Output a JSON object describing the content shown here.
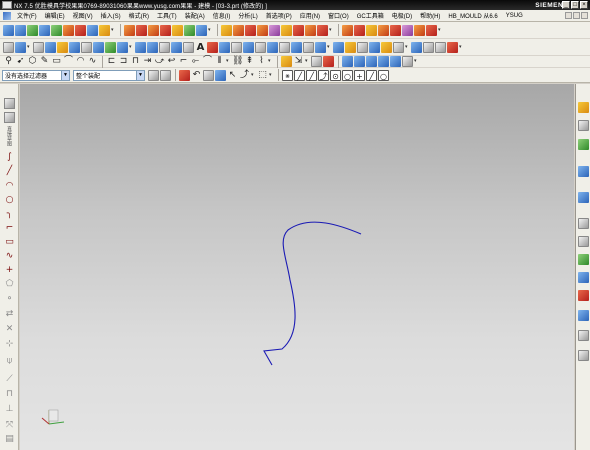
{
  "window": {
    "title": "NX 7.5 优胜模具学校果果0769-89031060果果www.yusg.com果果 - 建模 - [03-3.prt (修改的) ]",
    "brand": "SIEMENS",
    "minimize": "_",
    "maximize": "□",
    "close": "×"
  },
  "menu": {
    "items": [
      "文件(F)",
      "编辑(E)",
      "视图(V)",
      "插入(S)",
      "格式(R)",
      "工具(T)",
      "装配(A)",
      "信息(I)",
      "分析(L)",
      "首选项(P)",
      "应用(N)",
      "窗口(O)",
      "GC工具箱",
      "电极(D)",
      "帮助(H)",
      "HB_MOULD 从6.6",
      "YSUG"
    ]
  },
  "selection_bar": {
    "filter_value": "没有选择过滤器",
    "scope_value": "整个装配"
  },
  "left_toolbar": {
    "sketch_label": "直接草图"
  },
  "colors": {
    "curve": "#1a1ab4",
    "background_top": "#a7a7a7",
    "background_bottom": "#e4e4e4"
  }
}
